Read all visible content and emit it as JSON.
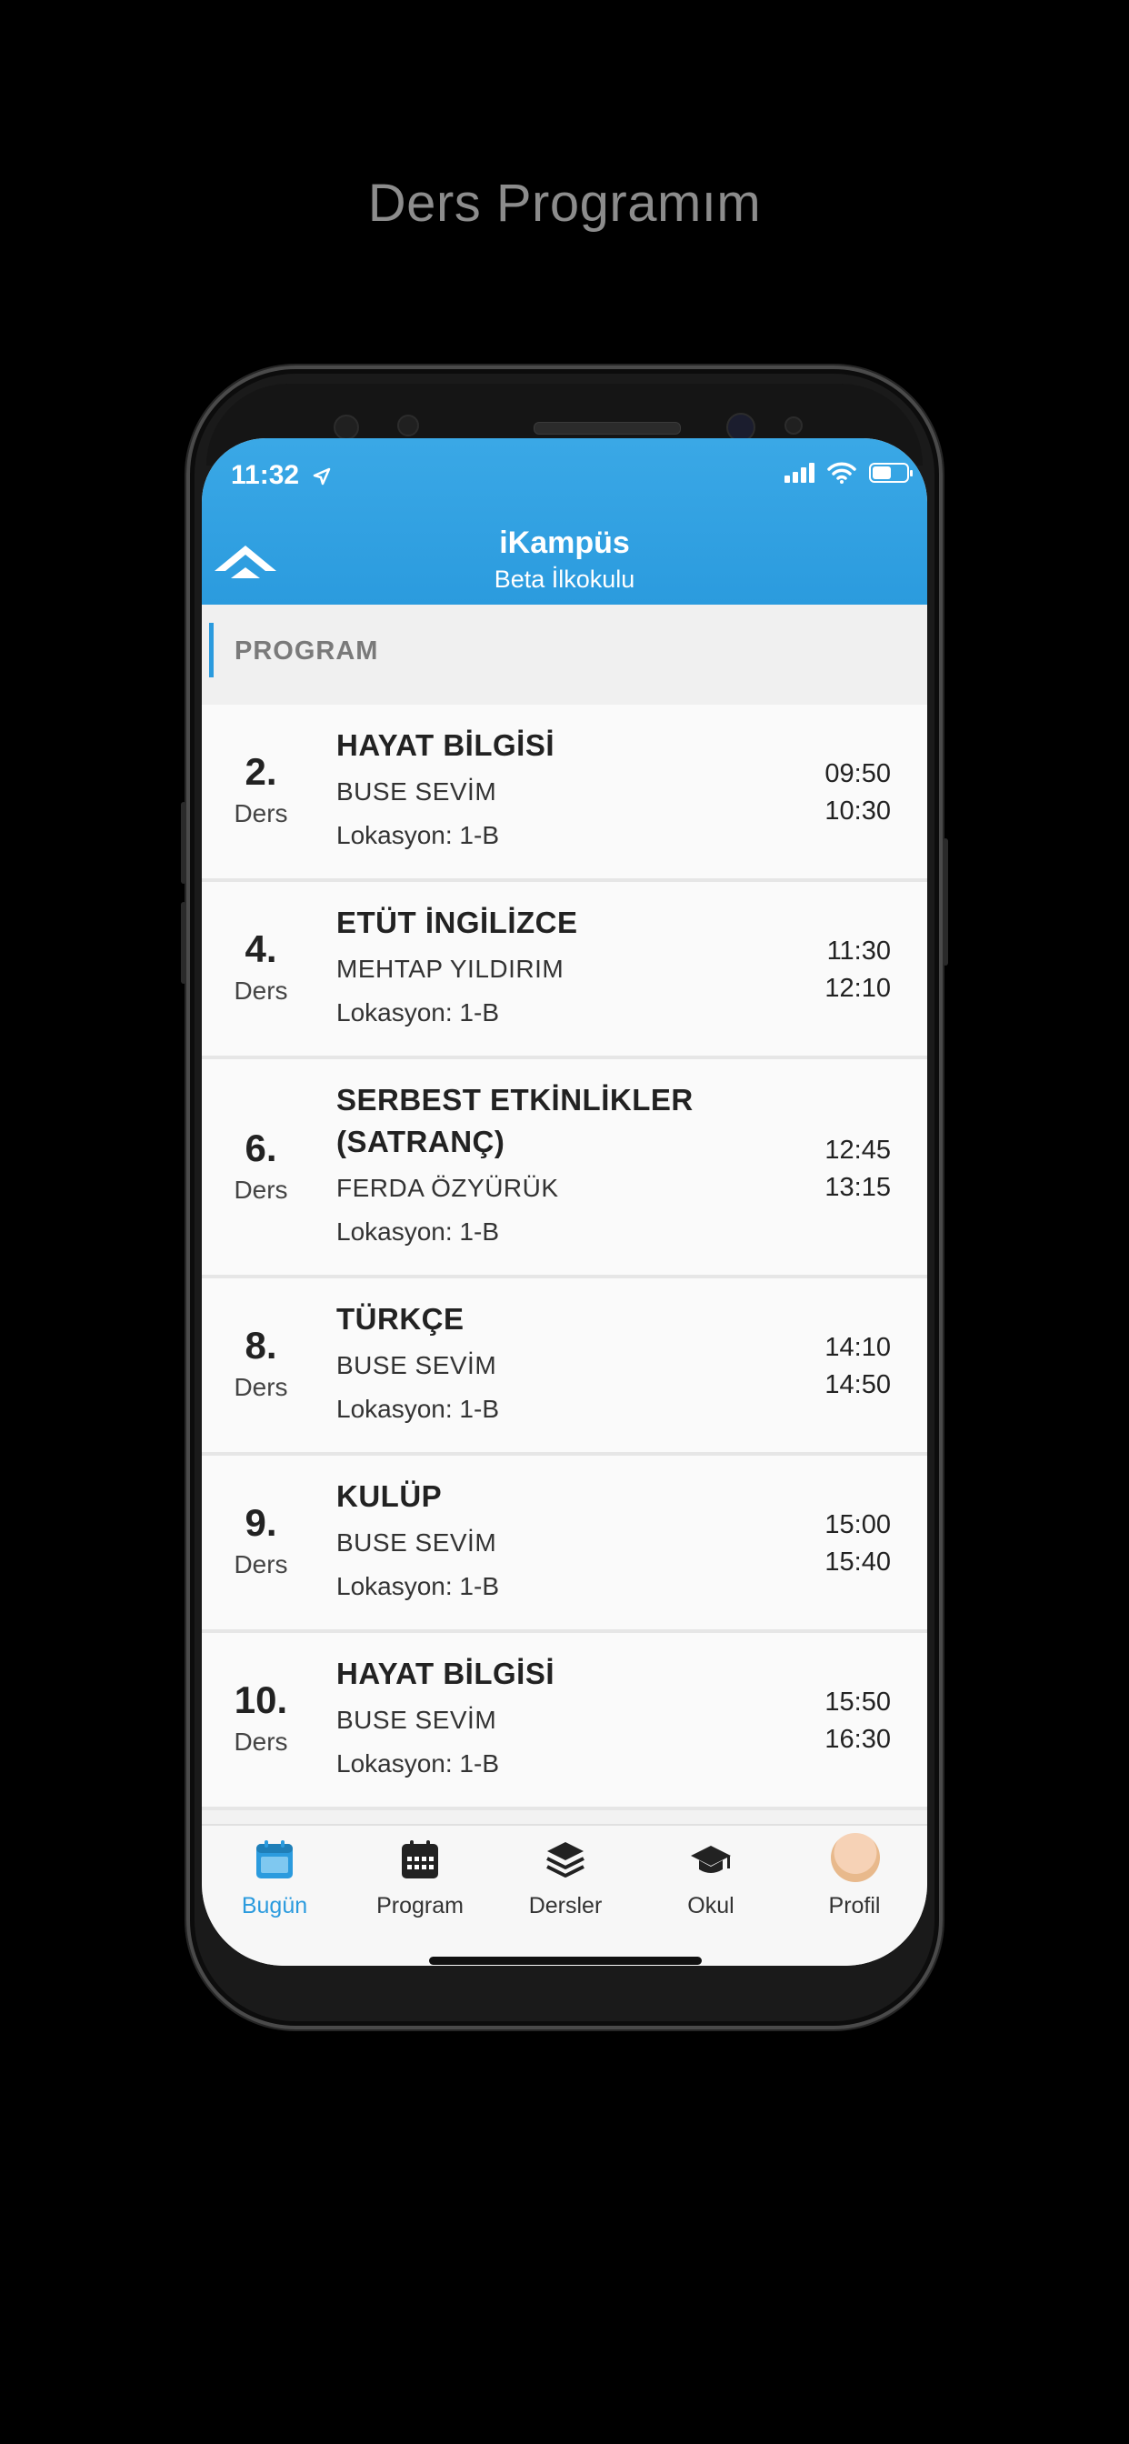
{
  "promo": {
    "title": "Ders Programım"
  },
  "status_bar": {
    "time": "11:32"
  },
  "header": {
    "title": "iKampüs",
    "subtitle": "Beta İlkokulu"
  },
  "section": {
    "label": "PROGRAM"
  },
  "lessons": [
    {
      "period": "2.",
      "label": "Ders",
      "subject": "HAYAT BİLGİSİ",
      "teacher": "BUSE SEVİM",
      "location": "Lokasyon: 1-B",
      "start": "09:50",
      "end": "10:30"
    },
    {
      "period": "4.",
      "label": "Ders",
      "subject": "ETÜT İNGİLİZCE",
      "teacher": "MEHTAP YILDIRIM",
      "location": "Lokasyon: 1-B",
      "start": "11:30",
      "end": "12:10"
    },
    {
      "period": "6.",
      "label": "Ders",
      "subject": "SERBEST ETKİNLİKLER (SATRANÇ)",
      "teacher": "FERDA ÖZYÜRÜK",
      "location": "Lokasyon: 1-B",
      "start": "12:45",
      "end": "13:15"
    },
    {
      "period": "8.",
      "label": "Ders",
      "subject": "TÜRKÇE",
      "teacher": "BUSE SEVİM",
      "location": "Lokasyon: 1-B",
      "start": "14:10",
      "end": "14:50"
    },
    {
      "period": "9.",
      "label": "Ders",
      "subject": "KULÜP",
      "teacher": "BUSE SEVİM",
      "location": "Lokasyon: 1-B",
      "start": "15:00",
      "end": "15:40"
    },
    {
      "period": "10.",
      "label": "Ders",
      "subject": "HAYAT BİLGİSİ",
      "teacher": "BUSE SEVİM",
      "location": "Lokasyon: 1-B",
      "start": "15:50",
      "end": "16:30"
    }
  ],
  "tabbar": {
    "items": [
      {
        "label": "Bugün",
        "icon": "calendar-today-icon",
        "active": true
      },
      {
        "label": "Program",
        "icon": "calendar-grid-icon",
        "active": false
      },
      {
        "label": "Dersler",
        "icon": "layers-icon",
        "active": false
      },
      {
        "label": "Okul",
        "icon": "graduation-cap-icon",
        "active": false
      },
      {
        "label": "Profil",
        "icon": "avatar",
        "active": false
      }
    ]
  },
  "colors": {
    "accent": "#2b9bde",
    "header": "#3aa8e6",
    "background": "#000000"
  }
}
